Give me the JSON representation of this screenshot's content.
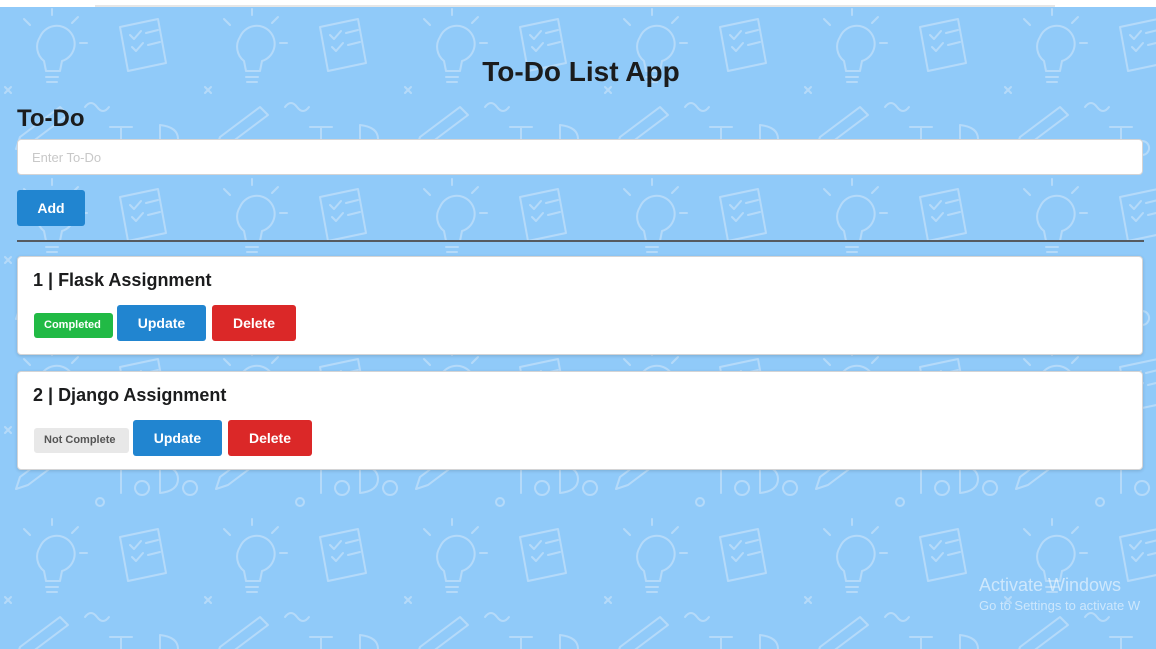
{
  "app": {
    "title": "To-Do List App"
  },
  "form": {
    "section_title": "To-Do",
    "input_placeholder": "Enter To-Do",
    "input_value": "",
    "add_label": "Add"
  },
  "todos": [
    {
      "id": "1",
      "separator": "|",
      "title": "Flask Assignment",
      "status": "Completed",
      "status_color": "#21ba45",
      "update_label": "Update",
      "delete_label": "Delete"
    },
    {
      "id": "2",
      "separator": "|",
      "title": "Django Assignment",
      "status": "Not Complete",
      "status_color": "#e8e8e8",
      "update_label": "Update",
      "delete_label": "Delete"
    }
  ],
  "watermark": {
    "line1": "Activate Windows",
    "line2": "Go to Settings to activate W"
  },
  "colors": {
    "background": "#90caf9",
    "primary": "#2185d0",
    "danger": "#db2828",
    "success": "#21ba45"
  },
  "background_icons": [
    "lightbulb-icon",
    "checklist-icon",
    "pencil-icon",
    "todo-text-doodle"
  ]
}
